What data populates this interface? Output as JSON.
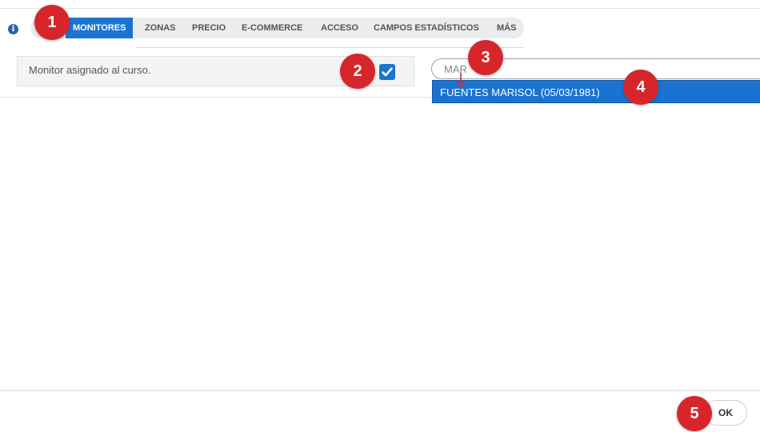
{
  "tabs": [
    {
      "label": "MONITORES",
      "active": true
    },
    {
      "label": "ZONAS",
      "active": false
    },
    {
      "label": "PRECIO",
      "active": false
    },
    {
      "label": "E-COMMERCE",
      "active": false
    },
    {
      "label": "ACCESO",
      "active": false
    },
    {
      "label": "CAMPOS ESTADÍSTICOS",
      "active": false
    },
    {
      "label": "MÁS",
      "active": false
    }
  ],
  "monitor_field": {
    "label": "Monitor asignado al curso.",
    "checked": true
  },
  "search": {
    "value": "MAR"
  },
  "dropdown": {
    "option": "FUENTES MARISOL (05/03/1981)"
  },
  "footer": {
    "ok_label": "OK"
  },
  "markers": [
    "1",
    "2",
    "3",
    "4",
    "5"
  ],
  "colors": {
    "accent": "#1a73d1",
    "marker": "#d7262b"
  },
  "icons": {
    "info": "info-icon",
    "check": "check-icon",
    "cursor": "cursor-arrow-icon"
  }
}
